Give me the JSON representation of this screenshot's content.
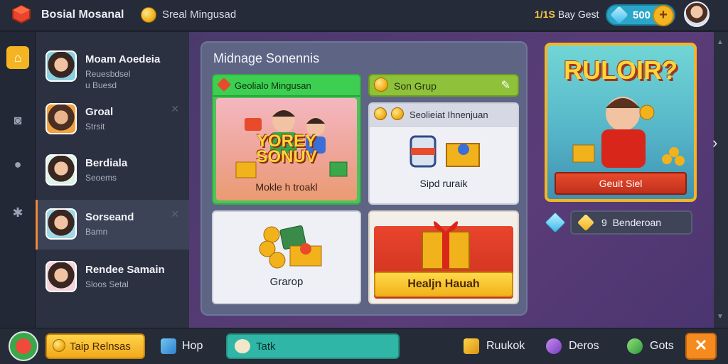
{
  "header": {
    "app_title": "Bosial Mosanal",
    "subtitle": "Sreal Mingusad",
    "badge_prefix": "1/1S",
    "badge_text": "Bay Gest",
    "gem_count": "500",
    "plus_label": "+"
  },
  "rail": {
    "icons": [
      "home-icon",
      "camera-icon",
      "gamepad-icon",
      "settings-icon"
    ]
  },
  "contacts": [
    {
      "name": "Moam Aoedeia",
      "status": "Reuesbdsel",
      "status2": "u Buesd"
    },
    {
      "name": "Groal",
      "status": "Strsit"
    },
    {
      "name": "Berdiala",
      "status": "Seoems"
    },
    {
      "name": "Sorseand",
      "status": "Bamn"
    },
    {
      "name": "Rendee Samain",
      "status": "Sloos Setal"
    }
  ],
  "panel": {
    "title": "Midnage Sonennis",
    "card_a": {
      "header": "Geolialo Mingusan",
      "promo": "YOREY SONUV",
      "caption": "Mokle h troakl"
    },
    "card_b": {
      "label": "Son Grup"
    },
    "card_c": {
      "header": "Seolieiat Ihnenjuan",
      "caption": "Sipd ruraik"
    },
    "card_d": {
      "caption": "Grarop"
    },
    "card_e": {
      "caption": "Healjn Hauah"
    }
  },
  "feature": {
    "title": "RULOIR?",
    "button": "Geuit Siel"
  },
  "gem_row": {
    "prefix": "9",
    "label": "Benderoan"
  },
  "bottom": {
    "primary": "Taip Relnsas",
    "hop": "Hop",
    "talk": "Tatk",
    "runkok": "Ruukok",
    "deros": "Deros",
    "gots": "Gots",
    "close": "✕"
  },
  "colors": {
    "accent": "#f5b523",
    "talk": "#2fb6a6",
    "card_green": "#3ccf52",
    "close": "#f58a1f"
  }
}
